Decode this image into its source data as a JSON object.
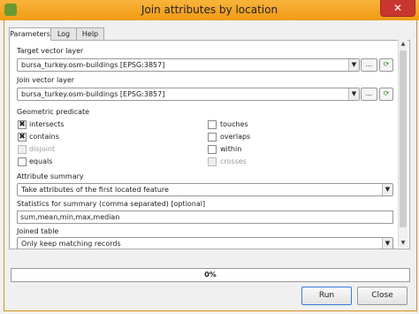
{
  "window": {
    "title": "Join attributes by location",
    "close_glyph": "✕"
  },
  "tabs": [
    {
      "label": "Parameters"
    },
    {
      "label": "Log"
    },
    {
      "label": "Help"
    }
  ],
  "form": {
    "target_label": "Target vector layer",
    "target_value": "bursa_turkey.osm-buildings [EPSG:3857]",
    "join_label": "Join vector layer",
    "join_value": "bursa_turkey.osm-buildings [EPSG:3857]",
    "ellipsis": "...",
    "predicate_label": "Geometric predicate",
    "predicates": {
      "intersects": {
        "label": "intersects",
        "checked": true
      },
      "contains": {
        "label": "contains",
        "checked": true
      },
      "disjoint": {
        "label": "disjoint",
        "checked": false
      },
      "equals": {
        "label": "equals",
        "checked": false
      },
      "touches": {
        "label": "touches",
        "checked": false
      },
      "overlaps": {
        "label": "overlaps",
        "checked": false
      },
      "within": {
        "label": "within",
        "checked": false
      },
      "crosses": {
        "label": "crosses",
        "checked": false
      }
    },
    "summary_label": "Attribute summary",
    "summary_value": "Take attributes of the first located feature",
    "stats_label": "Statistics for summary (comma separated) [optional]",
    "stats_value": "sum,mean,min,max,median",
    "joined_label": "Joined table",
    "joined_value": "Only keep matching records"
  },
  "progress": {
    "text": "0%",
    "value": 0
  },
  "buttons": {
    "run": "Run",
    "close": "Close"
  }
}
